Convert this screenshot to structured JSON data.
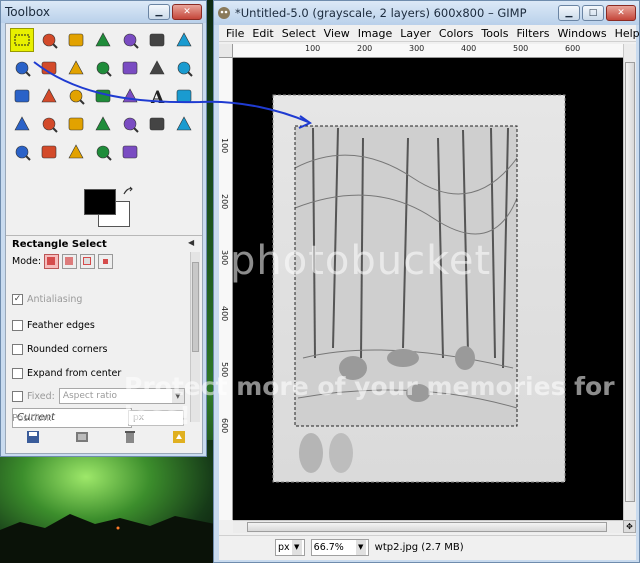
{
  "toolbox": {
    "title": "Toolbox",
    "tools": [
      "rect-select-icon",
      "ellipse-select-icon",
      "lasso-icon",
      "fuzzy-select-icon",
      "color-select-icon",
      "scissors-icon",
      "foreground-select-icon",
      "paths-icon",
      "color-picker-icon",
      "zoom-icon",
      "measure-icon",
      "move-icon",
      "align-icon",
      "crop-icon",
      "rotate-icon",
      "scale-icon",
      "shear-icon",
      "perspective-icon",
      "flip-icon",
      "text-icon",
      "bucket-fill-icon",
      "blend-icon",
      "pencil-icon",
      "paintbrush-icon",
      "eraser-icon",
      "airbrush-icon",
      "ink-icon",
      "clone-icon",
      "heal-icon",
      "perspective-clone-icon",
      "blur-icon",
      "smudge-icon",
      "dodge-burn-icon"
    ],
    "options_title": "Rectangle Select",
    "mode_label": "Mode:",
    "antialiasing": "Antialiasing",
    "feather_edges": "Feather edges",
    "rounded_corners": "Rounded corners",
    "expand_from_center": "Expand from center",
    "fixed_label": "Fixed:",
    "fixed_value": "Aspect ratio",
    "entry_value": "Current",
    "position_label": "Position:",
    "position_unit": "px"
  },
  "gimp": {
    "title": "*Untitled-5.0 (grayscale, 2 layers) 600x800 – GIMP",
    "menu": [
      "File",
      "Edit",
      "Select",
      "View",
      "Image",
      "Layer",
      "Colors",
      "Tools",
      "Filters",
      "Windows",
      "Help"
    ],
    "ruler_h": [
      "100",
      "200",
      "300",
      "400",
      "500",
      "600"
    ],
    "ruler_v": [
      "100",
      "200",
      "300",
      "400",
      "500",
      "600"
    ],
    "unit": "px",
    "zoom": "66.7%",
    "status": "wtp2.jpg (2.7 MB)"
  },
  "watermark": {
    "line1": "photobucket",
    "line2": "Protect more of your memories for less!"
  }
}
